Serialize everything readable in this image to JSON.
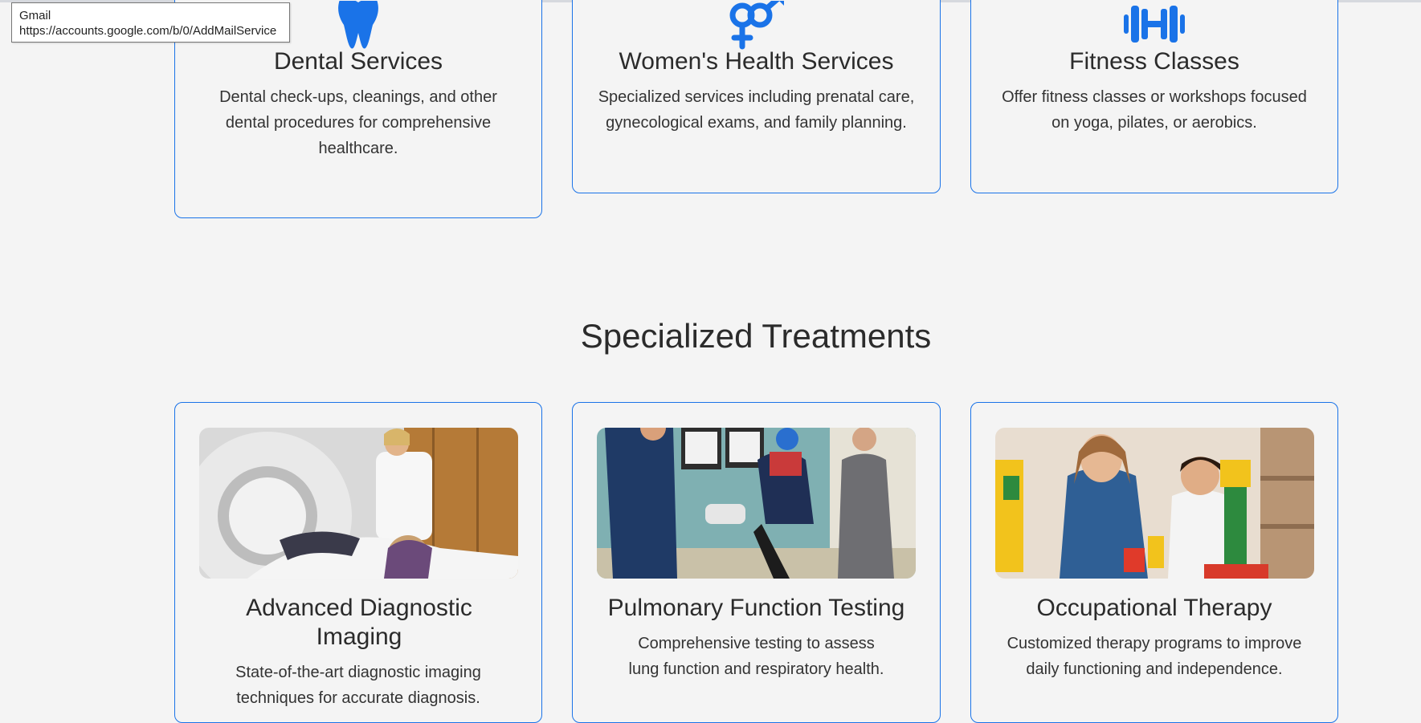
{
  "tooltip": {
    "title": "Gmail",
    "url": "https://accounts.google.com/b/0/AddMailService"
  },
  "colors": {
    "accent": "#1a73e8",
    "background": "#f4f4f4",
    "text": "#2b2b2b"
  },
  "services": [
    {
      "icon": "tooth-icon",
      "title": "Dental Services",
      "description": "Dental check-ups, cleanings, and other dental procedures for comprehensive healthcare."
    },
    {
      "icon": "gender-symbols-icon",
      "title": "Women's Health Services",
      "description": "Specialized services including prenatal care, gynecological exams, and family planning."
    },
    {
      "icon": "dumbbell-icon",
      "title": "Fitness Classes",
      "description": "Offer fitness classes or workshops focused on yoga, pilates, or aerobics."
    }
  ],
  "specialized": {
    "heading": "Specialized Treatments",
    "items": [
      {
        "image": "diagnostic-imaging-photo",
        "title": "Advanced Diagnostic Imaging",
        "description": "State-of-the-art diagnostic imaging techniques for accurate diagnosis."
      },
      {
        "image": "pulmonary-testing-photo",
        "title": "Pulmonary Function Testing",
        "description": "Comprehensive testing to assess lung function and respiratory health."
      },
      {
        "image": "occupational-therapy-photo",
        "title": "Occupational Therapy",
        "description": "Customized therapy programs to improve daily functioning and independence."
      }
    ]
  }
}
